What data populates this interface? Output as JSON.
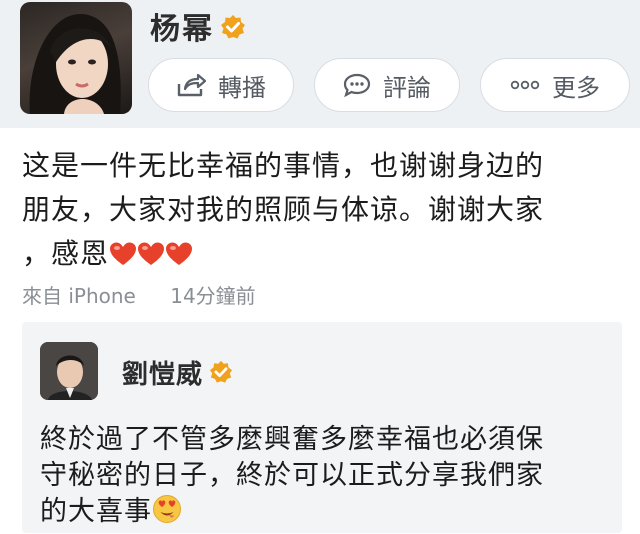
{
  "post": {
    "author": "杨幂",
    "actions": [
      {
        "label": "轉播",
        "icon": "share-icon"
      },
      {
        "label": "評論",
        "icon": "comment-icon"
      },
      {
        "label": "更多",
        "icon": "more-icon"
      }
    ],
    "text_lines": [
      "这是一件无比幸福的事情，也谢谢身边的",
      "朋友，大家对我的照顾与体谅。谢谢大家",
      "，感恩"
    ],
    "source": "來自 iPhone",
    "time": "14分鐘前"
  },
  "quote": {
    "author": "劉愷威",
    "text_lines": [
      "終於過了不管多麼興奮多麼幸福也必須保",
      "守秘密的日子，終於可以正式分享我們家",
      "的大喜事"
    ]
  },
  "colors": {
    "verified": "#f0a21e",
    "heart": "#e8412b",
    "header_bg": "#eef1f4",
    "quote_bg": "#f2f4f6"
  }
}
